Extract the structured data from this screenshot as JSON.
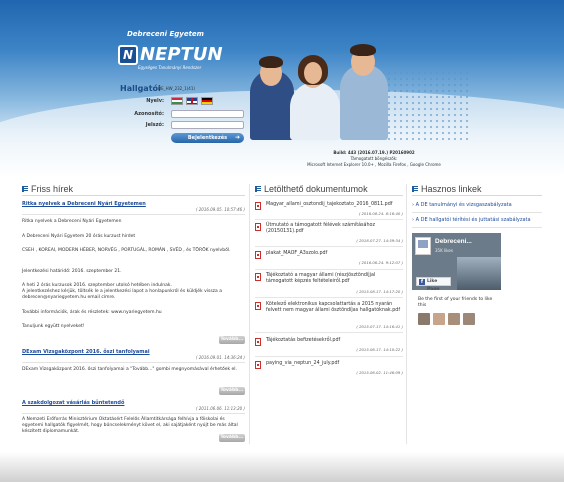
{
  "header": {
    "university": "Debreceni Egyetem",
    "logo_word": "NEPTUN",
    "logo_letter": "N",
    "logo_tagline": "Egységes Tanulmányi Rendszer",
    "section": "Hallgatói",
    "section_code": "DE_HW_232_1(41)",
    "lang_label": "Nyelv:",
    "user_label": "Azonosító:",
    "pass_label": "Jelszó:",
    "login_button": "Bejelentkezés",
    "build_line": "Build: 443 (2016.07.19.) P20160902",
    "supported_label": "Támogatott böngészők:",
    "browsers": "Microsoft Internet Explorer 10.0+ , Mozilla Firefox , Google Chrome"
  },
  "news": {
    "title": "Friss hírek",
    "more_label": "Tovább...",
    "items": [
      {
        "title": "Ritka nyelvek a Debreceni Nyári Egyetemen",
        "date": "( 2016.09.05. 10:57:46 )"
      },
      {
        "title": "DExam Vizsgaközpont 2016. őszi tanfolyamai",
        "date": "( 2016.09.01. 14:36:24 )"
      },
      {
        "title": "A szakdolgozat vásárlás bűntetendő",
        "date": "( 2011.06.06. 11:13:20 )"
      }
    ],
    "body1": [
      "Ritka nyelvek a Debreceni Nyári Egyetemen",
      "A Debreceni Nyári Egyetem 20 órás kurzust hirdet",
      "CSEH , KOREAI, MODERN HÉBER, NORVÉG , PORTUGÁL, ROMÁN , SVÉD , és TÖRÖK nyelvből.",
      "Jelentkezési határidő: 2016. szeptember 21.",
      "A heti 2 órás kurzusok 2016. szeptember utolsó hetében indulnak.",
      "A jelentkezéshez kérjük, töltsék le a jelentkezési lapot a honlapunkról és küldjék vissza a debrecen@nyariegyetem.hu email címre.",
      "További információk, árak és részletek: www.nyariegyetem.hu",
      "Tanuljunk együtt nyelveket!"
    ],
    "body2": "DExam Vizsgaközpont 2016. őszi tanfolyamai a \"Tovább...\" gombi megnyomásával érhetőek el.",
    "body3": "A Nemzeti Erőforrás Minisztérium Oktatásért Felelős Államtitkársága felhívja a főiskolai és egyetemi hallgatók figyelmét, hogy bűncselekményt követ el, aki sajátjaként nyújt be más által készített diplomamunkát."
  },
  "docs": {
    "title": "Letölthető dokumentumok",
    "items": [
      {
        "name": "Magyar_allami_osztondij_tajekoztato_2016_0811.pdf",
        "date": "( 2016.08.24. 8:16:40 )"
      },
      {
        "name": "Útmutató a támogatott félévek számításához (20150131).pdf",
        "date": "( 2016.07.27. 14:59:34 )"
      },
      {
        "name": "plakat_MAOF_A3szolo.pdf",
        "date": "( 2016.06.24. 9:12:07 )"
      },
      {
        "name": "Tájékoztató a magyar állami (részjösztöndíjjal támogatott képzés feltételeiről.pdf",
        "date": "( 2015.08.17. 14:17:20 )"
      },
      {
        "name": "Kötelező elektronikus kapcsolattartás a 2015 nyarán felvett nem magyar állami ösztöndíjas hallgatóknak.pdf",
        "date": "( 2015.07.17. 14:16:41 )"
      },
      {
        "name": "Tájékoztatás befizetésekről.pdf",
        "date": "( 2015.06.17. 14:10:22 )"
      },
      {
        "name": "paying_via_neptun_24_july.pdf",
        "date": "( 2015.06.02. 11:46:09 )"
      }
    ]
  },
  "links": {
    "title": "Hasznos linkek",
    "items": [
      "A DE tanulmányi és vizsgaszabályzata",
      "A DE hallgatói térítési és juttatási szabályzata"
    ]
  },
  "facebook": {
    "page_title": "Debreceni...",
    "likes": "35K likes",
    "like_button": "Like Page",
    "friends_text": "Be the first of your friends to like this"
  }
}
